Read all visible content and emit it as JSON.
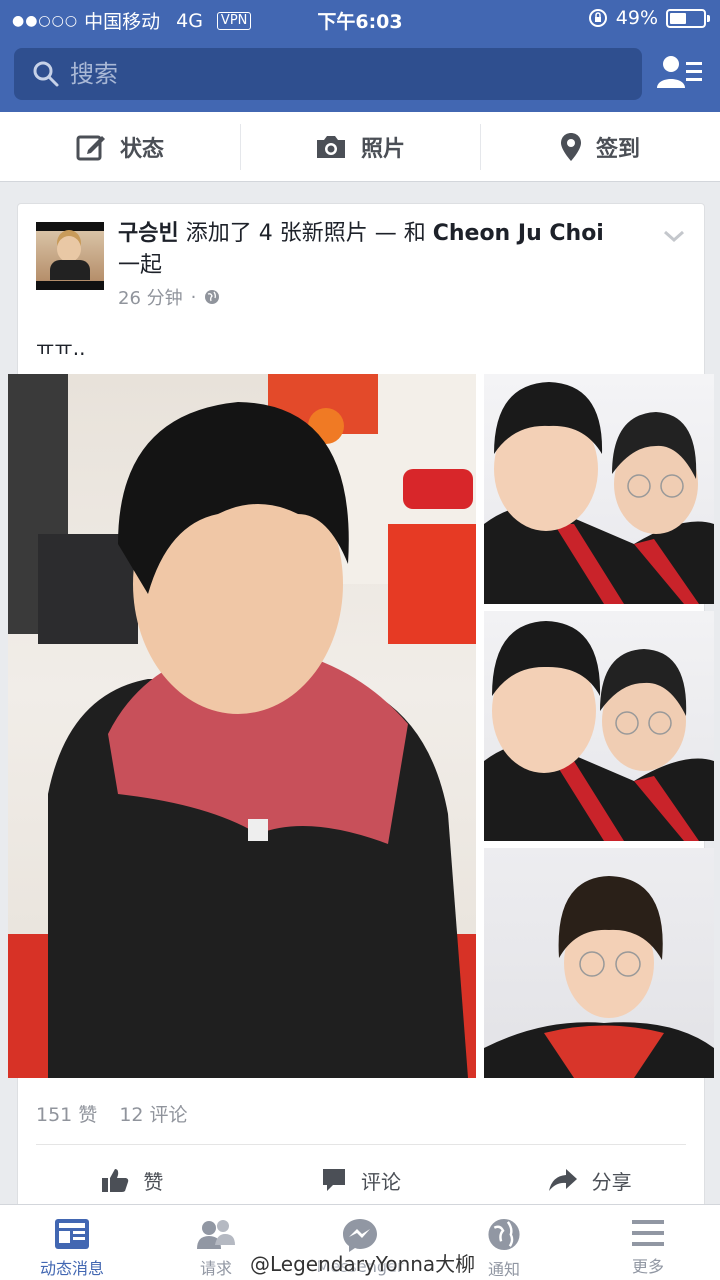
{
  "status_bar": {
    "carrier": "中国移动",
    "network": "4G",
    "vpn": "VPN",
    "time": "下午6:03",
    "battery": "49%",
    "battery_level": 0.49
  },
  "search": {
    "placeholder": "搜索"
  },
  "composer": {
    "status": "状态",
    "photo": "照片",
    "checkin": "签到"
  },
  "post": {
    "author": "구승빈",
    "action": "添加了 4 张新照片 — 和",
    "tagged": "Cheon Ju  Choi",
    "action_end": "一起",
    "time": "26 分钟",
    "dot": "·",
    "text": "ㅠㅠ..",
    "likes": "151 赞",
    "comments": "12 评论",
    "like_label": "赞",
    "comment_label": "评论",
    "share_label": "分享"
  },
  "tabs": [
    {
      "label": "动态消息",
      "active": true
    },
    {
      "label": "请求"
    },
    {
      "label": "Messenger"
    },
    {
      "label": "通知"
    },
    {
      "label": "更多"
    }
  ],
  "watermark": "@LegendaryYonna大柳",
  "colors": {
    "brand": "#4267b2",
    "background": "#e9ebee",
    "muted": "#90949c"
  }
}
